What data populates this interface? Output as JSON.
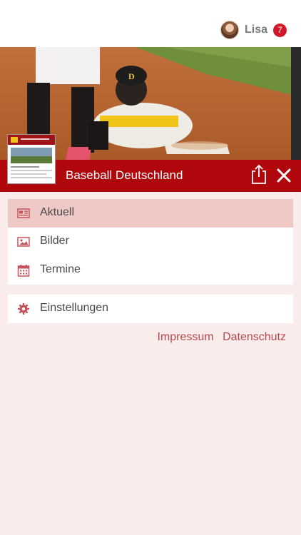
{
  "topbar": {
    "user_name": "Lisa",
    "notification_count": "7"
  },
  "header": {
    "site_title": "Baseball Deutschland"
  },
  "menu": {
    "items": [
      {
        "label": "Aktuell",
        "icon": "newspaper-icon",
        "active": true
      },
      {
        "label": "Bilder",
        "icon": "image-icon",
        "active": false
      },
      {
        "label": "Termine",
        "icon": "calendar-icon",
        "active": false
      }
    ],
    "settings": {
      "label": "Einstellungen",
      "icon": "gear-icon"
    }
  },
  "footer": {
    "impressum": "Impressum",
    "datenschutz": "Datenschutz"
  },
  "colors": {
    "brand_red": "#b0070d",
    "background": "#f9eceb",
    "active_item": "#efc9c6",
    "link": "#b5474f"
  }
}
